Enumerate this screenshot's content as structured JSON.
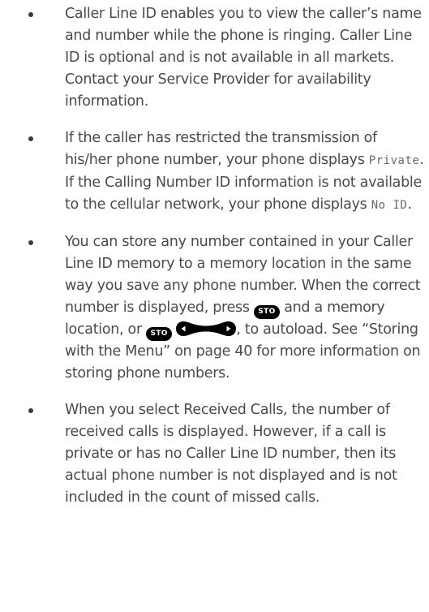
{
  "content": {
    "bullets": [
      {
        "text": "Caller Line ID enables you to view the caller’s name and number while the phone is ringing. Caller Line ID is optional and is not available in all markets. Contact your Service Provider for availability information."
      },
      {
        "part1": "If the caller has restricted the transmission of his/her phone number, your phone displays ",
        "display1": "Private",
        "part2": ". If the Calling Number ID information is not available to the cellular network, your phone displays ",
        "display2": "No ID",
        "part3": "."
      },
      {
        "part1": "You can store any number contained in your Caller Line ID memory to a memory location in the same way you save any phone number. When the correct number is displayed, press ",
        "key1": "STO",
        "part2": " and a memory location, or ",
        "key2": "STO",
        "part3": ", to autoload. See “Storing with the Menu” on page 40 for more information on storing phone numbers."
      },
      {
        "text": "When you select Received Calls, the number of received calls is displayed. However, if a call is private or has no Caller Line ID number, then its actual phone number is not displayed and is not included in the count of missed calls."
      }
    ],
    "icons": {
      "sto_key": "sto-key-icon",
      "nav_key": "left-right-scroll-key-icon"
    }
  }
}
